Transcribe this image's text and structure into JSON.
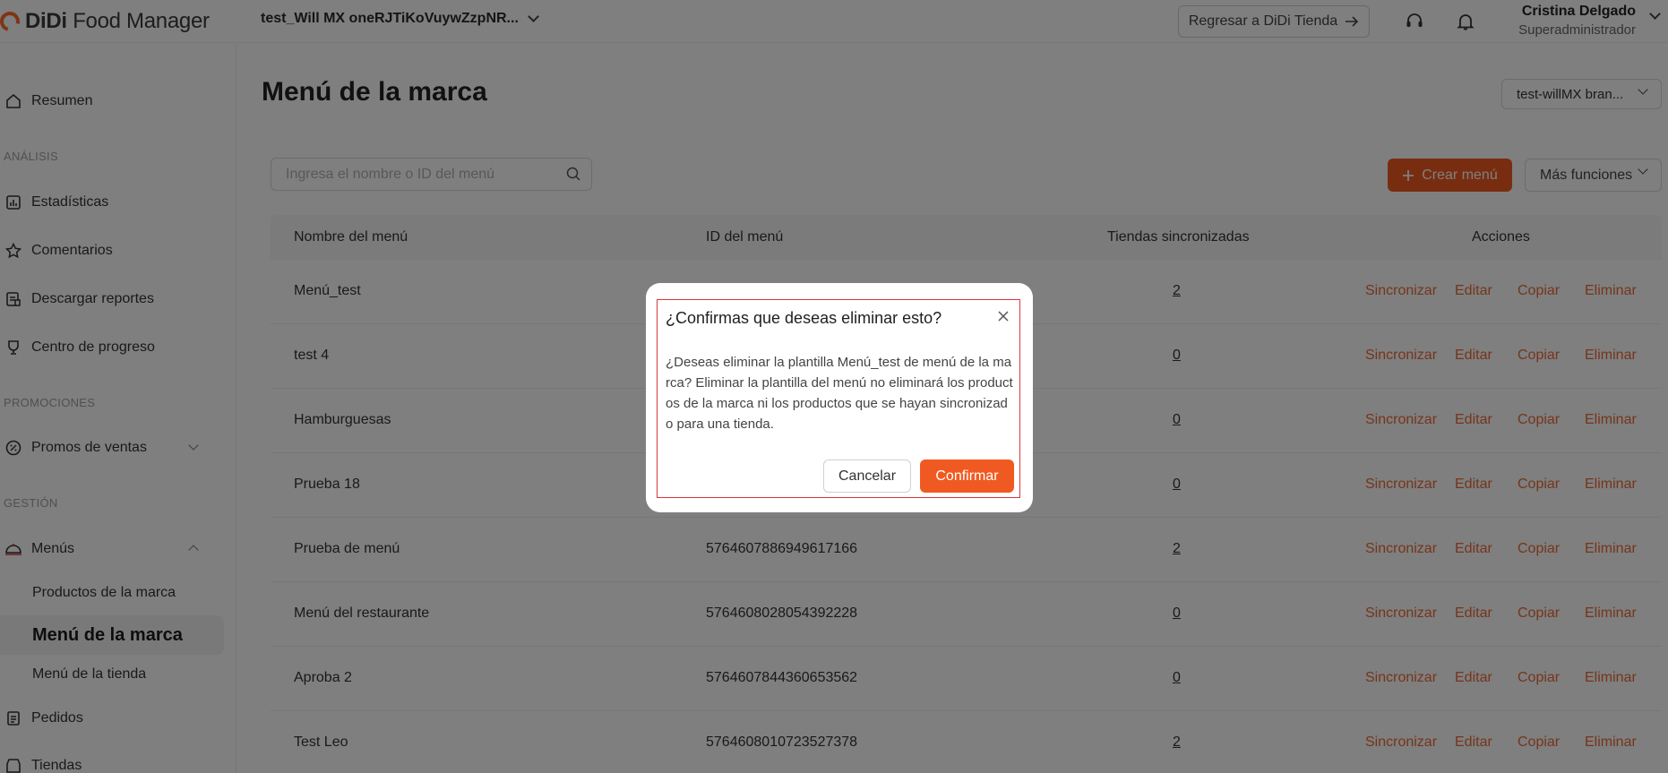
{
  "header": {
    "logo_brand": "DiDi",
    "logo_product": "Food Manager",
    "store_name": "test_Will MX oneRJTiKoVuywZzpNR...",
    "back_button": "Regresar a DiDi Tienda",
    "user_name": "Cristina Delgado",
    "user_role": "Superadministrador"
  },
  "sidebar": {
    "resumen": "Resumen",
    "section_analisis": "ANÁLISIS",
    "estadisticas": "Estadísticas",
    "comentarios": "Comentarios",
    "descargar": "Descargar reportes",
    "progreso": "Centro de progreso",
    "section_promociones": "PROMOCIONES",
    "promos": "Promos de ventas",
    "section_gestion": "GESTIÓN",
    "menus": "Menús",
    "productos_marca": "Productos de la marca",
    "menu_marca": "Menú de la marca",
    "menu_tienda": "Menú de la tienda",
    "pedidos": "Pedidos",
    "tiendas": "Tiendas"
  },
  "main": {
    "title": "Menú de la marca",
    "brand_select": "test-willMX bran...",
    "search_placeholder": "Ingresa el nombre o ID del menú",
    "create_button": "Crear menú",
    "more_button": "Más funciones",
    "columns": {
      "name": "Nombre del menú",
      "id": "ID del menú",
      "stores": "Tiendas sincronizadas",
      "actions": "Acciones"
    },
    "actions": {
      "sync": "Sincronizar",
      "edit": "Editar",
      "copy": "Copiar",
      "delete": "Eliminar"
    },
    "rows": [
      {
        "name": "Menú_test",
        "id": "",
        "stores": "2"
      },
      {
        "name": "test 4",
        "id": "",
        "stores": "0"
      },
      {
        "name": "Hamburguesas",
        "id": "",
        "stores": "0"
      },
      {
        "name": "Prueba 18",
        "id": "",
        "stores": "0"
      },
      {
        "name": "Prueba de menú",
        "id": "5764607886949617166",
        "stores": "2"
      },
      {
        "name": "Menú del restaurante",
        "id": "5764608028054392228",
        "stores": "0"
      },
      {
        "name": "Aproba 2",
        "id": "5764607844360653562",
        "stores": "0"
      },
      {
        "name": "Test Leo",
        "id": "5764608010723527378",
        "stores": "2"
      }
    ]
  },
  "modal": {
    "title": "¿Confirmas que deseas eliminar esto?",
    "body": "¿Deseas eliminar la plantilla Menú_test de menú de la marca? Eliminar la plantilla del menú no eliminará los productos de la marca ni los productos que se hayan sincronizado para una tienda.",
    "cancel": "Cancelar",
    "confirm": "Confirmar"
  },
  "colors": {
    "accent": "#f05a22",
    "action_link": "#ea6a36",
    "highlight_border": "#d9363e"
  }
}
